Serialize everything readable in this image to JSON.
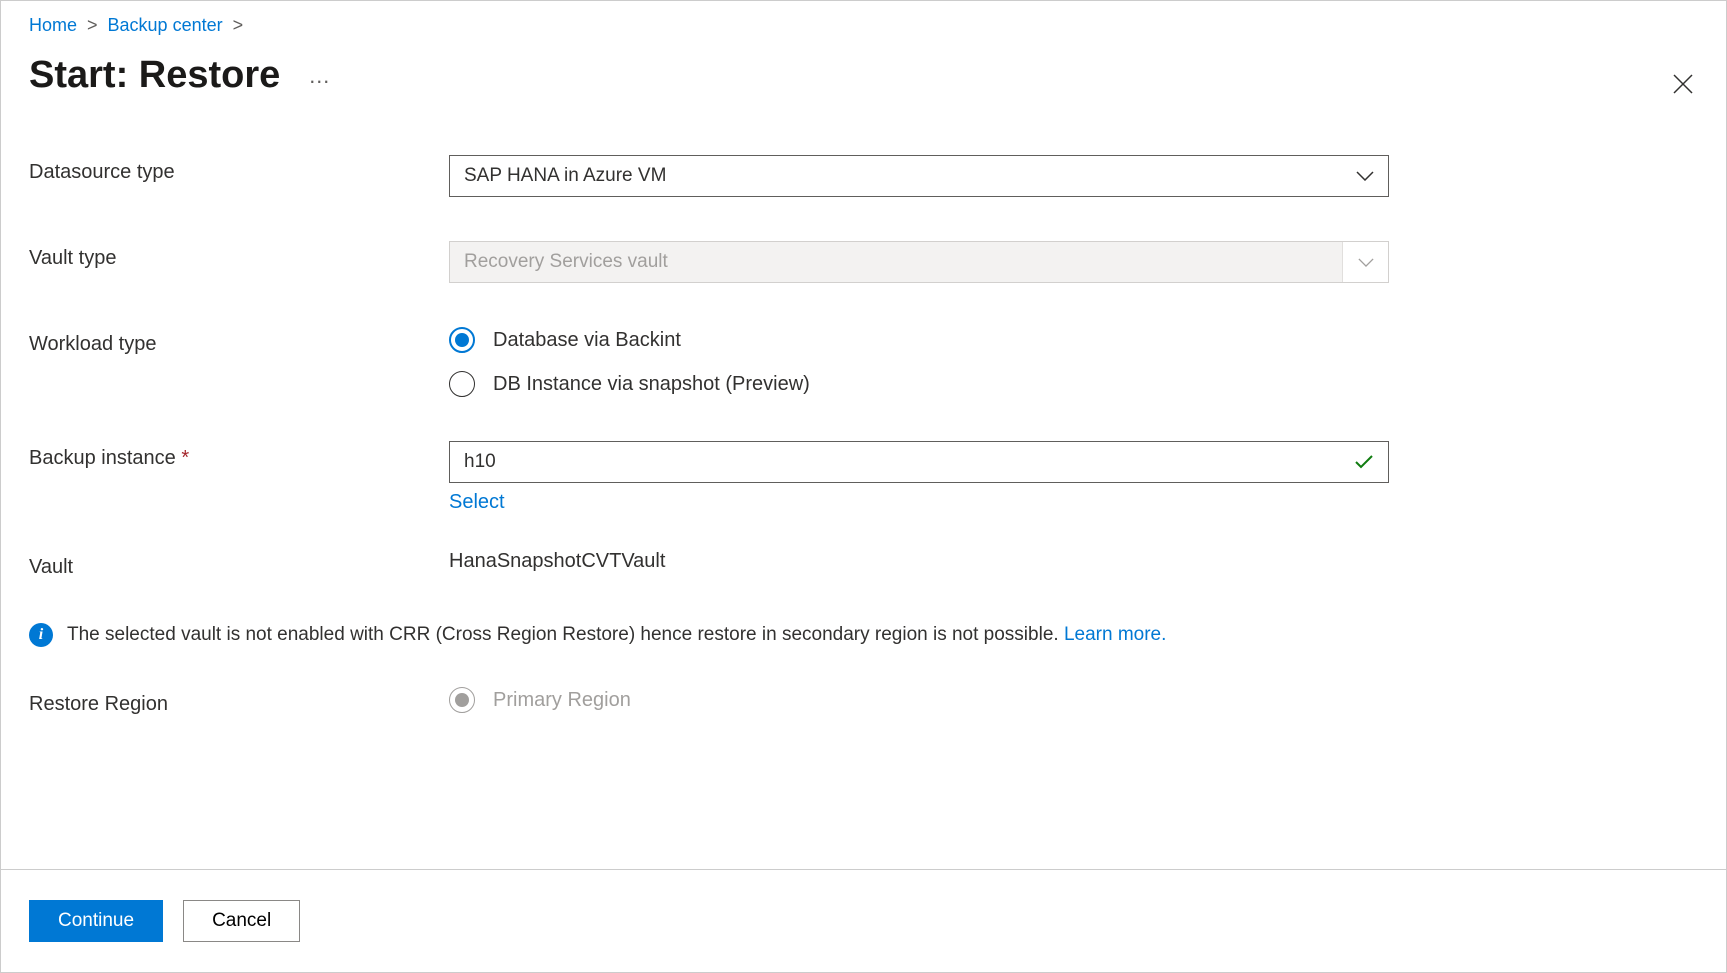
{
  "breadcrumb": {
    "home": "Home",
    "backup_center": "Backup center"
  },
  "page_title": "Start: Restore",
  "labels": {
    "datasource_type": "Datasource type",
    "vault_type": "Vault type",
    "workload_type": "Workload type",
    "backup_instance": "Backup instance",
    "vault": "Vault",
    "restore_region": "Restore Region"
  },
  "values": {
    "datasource_type": "SAP HANA in Azure VM",
    "vault_type": "Recovery Services vault",
    "backup_instance": "h10",
    "vault": "HanaSnapshotCVTVault"
  },
  "workload_options": {
    "backint": "Database via Backint",
    "snapshot": "DB Instance via snapshot (Preview)"
  },
  "restore_region_options": {
    "primary": "Primary Region"
  },
  "links": {
    "select": "Select",
    "learn_more": "Learn more."
  },
  "info_message": "The selected vault is not enabled with CRR (Cross Region Restore) hence restore in secondary region is not possible. ",
  "buttons": {
    "continue": "Continue",
    "cancel": "Cancel"
  }
}
